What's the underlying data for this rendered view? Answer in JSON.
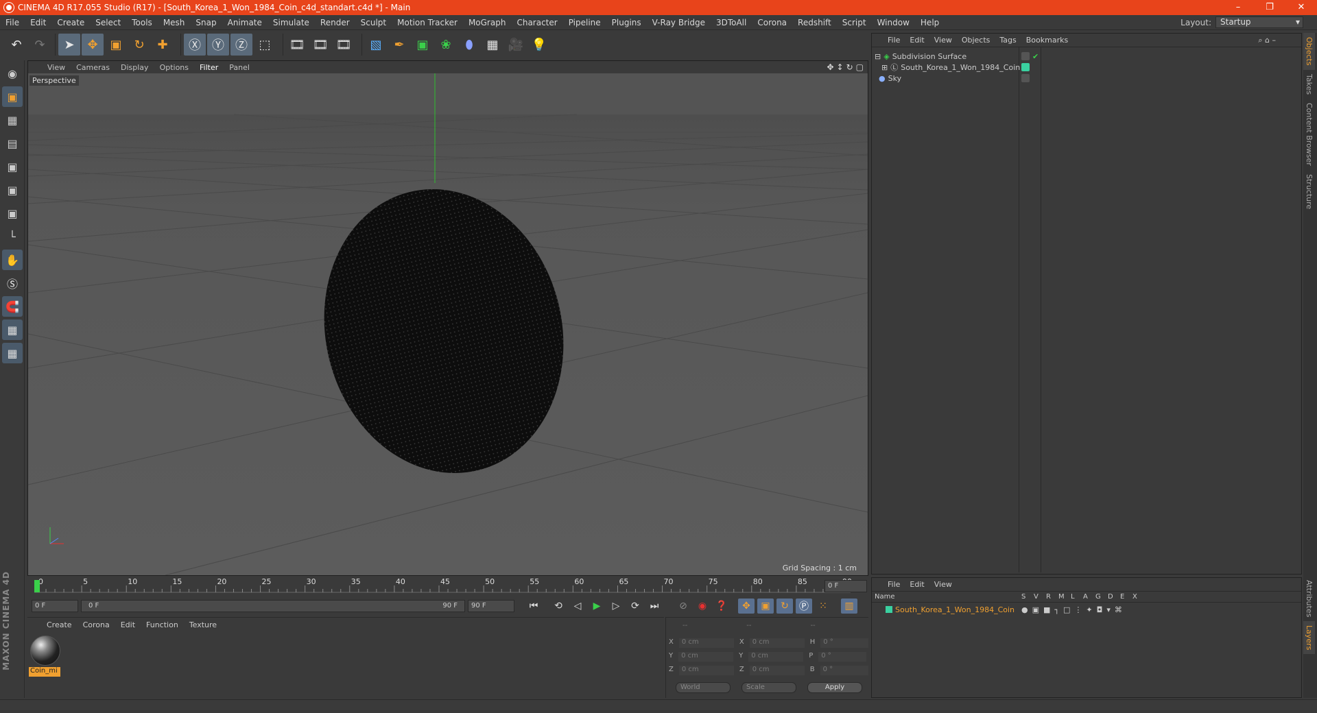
{
  "window": {
    "title": "CINEMA 4D R17.055 Studio (R17) - [South_Korea_1_Won_1984_Coin_c4d_standart.c4d *] - Main",
    "minimize": "–",
    "restore": "❐",
    "close": "✕"
  },
  "menubar": {
    "items": [
      "File",
      "Edit",
      "Create",
      "Select",
      "Tools",
      "Mesh",
      "Snap",
      "Animate",
      "Simulate",
      "Render",
      "Sculpt",
      "Motion Tracker",
      "MoGraph",
      "Character",
      "Pipeline",
      "Plugins",
      "V-Ray Bridge",
      "3DToAll",
      "Corona",
      "Redshift",
      "Script",
      "Window",
      "Help"
    ],
    "layout_label": "Layout:",
    "layout_value": "Startup"
  },
  "viewport": {
    "menu": [
      "View",
      "Cameras",
      "Display",
      "Options",
      "Filter",
      "Panel"
    ],
    "active_menu": "Filter",
    "label": "Perspective",
    "grid_spacing": "Grid Spacing : 1 cm"
  },
  "timeline": {
    "ticks": [
      "0",
      "5",
      "10",
      "15",
      "20",
      "25",
      "30",
      "35",
      "40",
      "45",
      "50",
      "55",
      "60",
      "65",
      "70",
      "75",
      "80",
      "85",
      "90"
    ],
    "current_frame": "0 F",
    "start_frame": "0 F",
    "range_start": "0 F",
    "range_end": "90 F",
    "end_frame": "90 F"
  },
  "material_panel": {
    "menu": [
      "Create",
      "Corona",
      "Edit",
      "Function",
      "Texture"
    ],
    "material_name": "Coin_mi"
  },
  "coords": {
    "header": [
      "--",
      "--",
      "--"
    ],
    "rows": [
      {
        "a": "X",
        "av": "0 cm",
        "b": "X",
        "bv": "0 cm",
        "c": "H",
        "cv": "0 °"
      },
      {
        "a": "Y",
        "av": "0 cm",
        "b": "Y",
        "bv": "0 cm",
        "c": "P",
        "cv": "0 °"
      },
      {
        "a": "Z",
        "av": "0 cm",
        "b": "Z",
        "bv": "0 cm",
        "c": "B",
        "cv": "0 °"
      }
    ],
    "world": "World",
    "scale": "Scale",
    "apply": "Apply"
  },
  "objects_panel": {
    "menu": [
      "File",
      "Edit",
      "View",
      "Objects",
      "Tags",
      "Bookmarks"
    ],
    "objects": [
      {
        "name": "Subdivision Surface"
      },
      {
        "name": "South_Korea_1_Won_1984_Coin"
      },
      {
        "name": "Sky"
      }
    ]
  },
  "side_tabs": [
    "Objects",
    "Takes",
    "Content Browser",
    "Structure"
  ],
  "side_tabs_lower": [
    "Attributes",
    "Layers"
  ],
  "layers_panel": {
    "menu": [
      "File",
      "Edit",
      "View"
    ],
    "columns": [
      "Name",
      "S",
      "V",
      "R",
      "M",
      "L",
      "A",
      "G",
      "D",
      "E",
      "X"
    ],
    "layer_name": "South_Korea_1_Won_1984_Coin"
  },
  "branding": "MAXON CINEMA 4D",
  "colors": {
    "title_bar": "#e8441b",
    "accent_orange": "#f0a030",
    "layer_green": "#3ad0a0"
  }
}
